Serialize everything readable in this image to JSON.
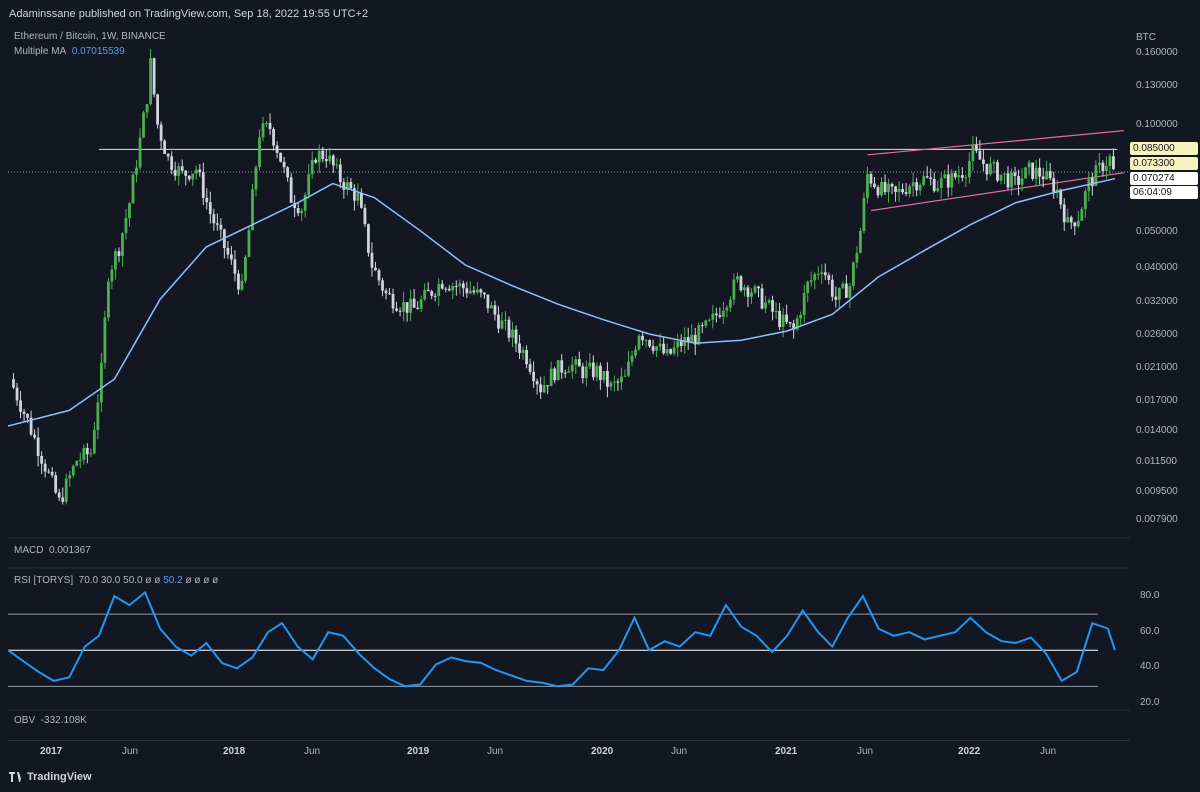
{
  "header": {
    "publisher_text": "Adaminssane published on TradingView.com, Sep 18, 2022 19:55 UTC+2"
  },
  "legend": {
    "symbol": "Ethereum / Bitcoin, 1W, BINANCE",
    "ma_label": "Multiple MA",
    "ma_value": "0.07015539",
    "macd_label": "MACD",
    "macd_value": "0.001367",
    "rsi_label": "RSI [TORYS]",
    "rsi_params": [
      "70.0",
      "30.0",
      "50.0",
      "ø",
      "ø"
    ],
    "rsi_value": "50.2",
    "rsi_tail": "ø ø ø ø",
    "obv_label": "OBV",
    "obv_value": "-332.108K"
  },
  "price_axis": {
    "currency": "BTC",
    "ticks": [
      "0.160000",
      "0.130000",
      "0.100000",
      "0.050000",
      "0.040000",
      "0.032000",
      "0.026000",
      "0.021000",
      "0.017000",
      "0.014000",
      "0.011500",
      "0.009500",
      "0.007900"
    ],
    "tags": {
      "resistance": "0.085000",
      "last": "0.073300",
      "ma": "0.070274",
      "countdown": "06:04:09"
    }
  },
  "rsi_axis": {
    "ticks": [
      "80.0",
      "60.0",
      "40.0",
      "20.0"
    ]
  },
  "time_axis": {
    "labels": [
      "2017",
      "Jun",
      "2018",
      "Jun",
      "2019",
      "Jun",
      "2020",
      "Jun",
      "2021",
      "Jun",
      "2022",
      "Jun"
    ]
  },
  "footer": {
    "brand": "TradingView"
  },
  "colors": {
    "bull": "#4caf50",
    "bear": "#d1d4dc",
    "ma": "#90bff9",
    "rsi": "#2196f3",
    "channel": "#e06c9f",
    "level": "#e8e6b5"
  },
  "chart_data": [
    {
      "type": "candlestick",
      "title": "Ethereum / Bitcoin, 1W, BINANCE",
      "yscale": "log",
      "ylim": [
        0.0072,
        0.17
      ],
      "xlim": [
        "2016-09-01",
        "2022-10-15"
      ],
      "horizontal_level": 0.085,
      "channel": {
        "upper": [
          [
            "2021-05-10",
            0.082
          ],
          [
            "2022-10-03",
            0.096
          ]
        ],
        "lower": [
          [
            "2021-05-17",
            0.057
          ],
          [
            "2022-10-03",
            0.073
          ]
        ]
      },
      "close_path": [
        [
          "2016-09-05",
          0.019
        ],
        [
          "2016-10-10",
          0.0145
        ],
        [
          "2016-11-14",
          0.0108
        ],
        [
          "2016-12-12",
          0.0085
        ],
        [
          "2017-01-16",
          0.0112
        ],
        [
          "2017-02-13",
          0.0118
        ],
        [
          "2017-03-06",
          0.02
        ],
        [
          "2017-03-20",
          0.038
        ],
        [
          "2017-04-10",
          0.045
        ],
        [
          "2017-05-01",
          0.06
        ],
        [
          "2017-05-22",
          0.09
        ],
        [
          "2017-06-05",
          0.12
        ],
        [
          "2017-06-12",
          0.148
        ],
        [
          "2017-06-26",
          0.1
        ],
        [
          "2017-07-17",
          0.08
        ],
        [
          "2017-08-14",
          0.072
        ],
        [
          "2017-09-11",
          0.075
        ],
        [
          "2017-10-09",
          0.056
        ],
        [
          "2017-11-06",
          0.045
        ],
        [
          "2017-12-11",
          0.034
        ],
        [
          "2017-12-25",
          0.05
        ],
        [
          "2018-01-15",
          0.095
        ],
        [
          "2018-02-05",
          0.098
        ],
        [
          "2018-02-26",
          0.08
        ],
        [
          "2018-03-19",
          0.062
        ],
        [
          "2018-04-09",
          0.058
        ],
        [
          "2018-05-07",
          0.082
        ],
        [
          "2018-05-28",
          0.082
        ],
        [
          "2018-06-25",
          0.07
        ],
        [
          "2018-07-30",
          0.062
        ],
        [
          "2018-08-27",
          0.04
        ],
        [
          "2018-09-24",
          0.033
        ],
        [
          "2018-10-22",
          0.031
        ],
        [
          "2018-11-19",
          0.03
        ],
        [
          "2018-12-17",
          0.033
        ],
        [
          "2019-01-14",
          0.036
        ],
        [
          "2019-02-11",
          0.035
        ],
        [
          "2019-03-11",
          0.034
        ],
        [
          "2019-04-08",
          0.032
        ],
        [
          "2019-05-06",
          0.028
        ],
        [
          "2019-06-03",
          0.025
        ],
        [
          "2019-07-01",
          0.022
        ],
        [
          "2019-07-29",
          0.018
        ],
        [
          "2019-08-26",
          0.02
        ],
        [
          "2019-09-23",
          0.021
        ],
        [
          "2019-10-21",
          0.02
        ],
        [
          "2019-11-18",
          0.02
        ],
        [
          "2019-12-16",
          0.018
        ],
        [
          "2020-01-13",
          0.019
        ],
        [
          "2020-02-10",
          0.026
        ],
        [
          "2020-03-09",
          0.024
        ],
        [
          "2020-04-06",
          0.022
        ],
        [
          "2020-05-04",
          0.024
        ],
        [
          "2020-06-01",
          0.025
        ],
        [
          "2020-06-29",
          0.027
        ],
        [
          "2020-07-27",
          0.031
        ],
        [
          "2020-08-24",
          0.036
        ],
        [
          "2020-09-21",
          0.034
        ],
        [
          "2020-10-19",
          0.031
        ],
        [
          "2020-11-16",
          0.028
        ],
        [
          "2020-12-14",
          0.026
        ],
        [
          "2021-01-11",
          0.035
        ],
        [
          "2021-02-08",
          0.04
        ],
        [
          "2021-03-08",
          0.032
        ],
        [
          "2021-04-05",
          0.035
        ],
        [
          "2021-04-26",
          0.05
        ],
        [
          "2021-05-10",
          0.072
        ],
        [
          "2021-06-07",
          0.065
        ],
        [
          "2021-07-05",
          0.063
        ],
        [
          "2021-08-02",
          0.068
        ],
        [
          "2021-08-30",
          0.07
        ],
        [
          "2021-09-27",
          0.068
        ],
        [
          "2021-10-25",
          0.07
        ],
        [
          "2021-11-22",
          0.075
        ],
        [
          "2021-12-06",
          0.083
        ],
        [
          "2022-01-03",
          0.076
        ],
        [
          "2022-01-31",
          0.072
        ],
        [
          "2022-02-28",
          0.068
        ],
        [
          "2022-03-28",
          0.074
        ],
        [
          "2022-04-25",
          0.072
        ],
        [
          "2022-05-23",
          0.065
        ],
        [
          "2022-06-13",
          0.052
        ],
        [
          "2022-07-04",
          0.055
        ],
        [
          "2022-07-25",
          0.068
        ],
        [
          "2022-08-22",
          0.077
        ],
        [
          "2022-09-05",
          0.08
        ],
        [
          "2022-09-12",
          0.0733
        ]
      ]
    },
    {
      "type": "line",
      "title": "Multiple MA",
      "yscale": "log",
      "ylim": [
        0.0072,
        0.17
      ],
      "x": [
        "2016-09-01",
        "2017-01-01",
        "2017-04-01",
        "2017-07-01",
        "2017-10-01",
        "2018-01-01",
        "2018-04-01",
        "2018-06-10",
        "2018-09-01",
        "2018-12-01",
        "2019-03-01",
        "2019-06-01",
        "2019-09-01",
        "2019-12-01",
        "2020-03-01",
        "2020-06-01",
        "2020-09-01",
        "2020-12-01",
        "2021-03-01",
        "2021-06-01",
        "2021-09-01",
        "2021-12-01",
        "2022-03-01",
        "2022-06-01",
        "2022-09-15"
      ],
      "values": [
        0.014,
        0.0155,
        0.019,
        0.032,
        0.045,
        0.052,
        0.06,
        0.068,
        0.062,
        0.05,
        0.04,
        0.035,
        0.031,
        0.028,
        0.0255,
        0.024,
        0.0245,
        0.026,
        0.029,
        0.037,
        0.044,
        0.052,
        0.06,
        0.065,
        0.0702
      ]
    },
    {
      "type": "line",
      "title": "RSI [TORYS]",
      "ylim": [
        18,
        90
      ],
      "levels": [
        70,
        50,
        30
      ],
      "x": [
        "2016-09-01",
        "2016-10-01",
        "2016-11-01",
        "2016-12-01",
        "2017-01-01",
        "2017-02-01",
        "2017-03-01",
        "2017-04-01",
        "2017-05-01",
        "2017-06-01",
        "2017-07-01",
        "2017-08-01",
        "2017-09-01",
        "2017-10-01",
        "2017-11-01",
        "2017-12-01",
        "2018-01-01",
        "2018-02-01",
        "2018-03-01",
        "2018-04-01",
        "2018-05-01",
        "2018-06-01",
        "2018-07-01",
        "2018-08-01",
        "2018-09-01",
        "2018-10-01",
        "2018-11-01",
        "2018-12-01",
        "2019-01-01",
        "2019-02-01",
        "2019-03-01",
        "2019-04-01",
        "2019-05-01",
        "2019-06-01",
        "2019-07-01",
        "2019-08-01",
        "2019-09-01",
        "2019-10-01",
        "2019-11-01",
        "2019-12-01",
        "2020-01-01",
        "2020-02-01",
        "2020-03-01",
        "2020-04-01",
        "2020-05-01",
        "2020-06-01",
        "2020-07-01",
        "2020-08-01",
        "2020-09-01",
        "2020-10-01",
        "2020-11-01",
        "2020-12-01",
        "2021-01-01",
        "2021-02-01",
        "2021-03-01",
        "2021-04-01",
        "2021-05-01",
        "2021-06-01",
        "2021-07-01",
        "2021-08-01",
        "2021-09-01",
        "2021-10-01",
        "2021-11-01",
        "2021-12-01",
        "2022-01-01",
        "2022-02-01",
        "2022-03-01",
        "2022-04-01",
        "2022-05-01",
        "2022-06-01",
        "2022-07-01",
        "2022-08-01",
        "2022-09-01",
        "2022-09-15"
      ],
      "values": [
        50,
        44,
        38,
        33,
        35,
        52,
        58,
        80,
        75,
        82,
        62,
        52,
        47,
        54,
        43,
        40,
        46,
        60,
        65,
        52,
        45,
        60,
        58,
        48,
        40,
        34,
        30,
        31,
        42,
        46,
        44,
        43,
        39,
        36,
        33,
        32,
        30,
        31,
        40,
        39,
        50,
        68,
        50,
        55,
        52,
        60,
        58,
        75,
        63,
        58,
        49,
        58,
        72,
        60,
        52,
        68,
        80,
        62,
        58,
        60,
        56,
        58,
        60,
        68,
        60,
        55,
        54,
        57,
        48,
        33,
        38,
        65,
        62,
        50
      ]
    }
  ]
}
